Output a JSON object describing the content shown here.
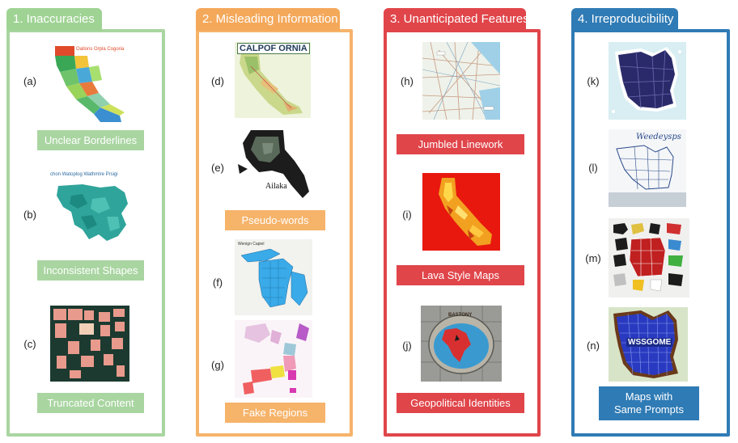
{
  "colors": {
    "green": "#a9d5a1",
    "green_tab": "#9fd394",
    "orange": "#f6b36a",
    "orange_tab": "#f4a85a",
    "red": "#e0454a",
    "red_tab": "#e0454a",
    "blue": "#2f7bb5",
    "blue_tab": "#2f7bb5"
  },
  "panels": [
    {
      "title": "1. Inaccuracies",
      "items": [
        {
          "label": "(a)",
          "caption": "Unclear Borderlines",
          "map_text": "Oallons Orpla Cogoria"
        },
        {
          "label": "(b)",
          "caption": "Inconsistent Shapes",
          "map_text": "chon Watoplog Wathmlre Prsigi"
        },
        {
          "label": "(c)",
          "caption": "Truncated Content"
        }
      ]
    },
    {
      "title": "2. Misleading Information",
      "items": [
        {
          "label": "(d)",
          "map_text": "CALPOF ORNIA"
        },
        {
          "label": "(e)",
          "map_text": "Ailaka"
        },
        {
          "label": "(f)",
          "map_text": "Wenign Capiel"
        },
        {
          "label": "(g)"
        }
      ],
      "captions": [
        "Pseudo-words",
        "Fake Regions"
      ]
    },
    {
      "title": "3. Unanticipated Features",
      "items": [
        {
          "label": "(h)",
          "caption": "Jumbled Linework"
        },
        {
          "label": "(i)",
          "caption": "Lava Style Maps"
        },
        {
          "label": "(j)",
          "caption": "Geopolitical Identities",
          "map_text": "BASTONY"
        }
      ]
    },
    {
      "title": "4. Irreproducibility",
      "items": [
        {
          "label": "(k)"
        },
        {
          "label": "(l)",
          "map_text": "Weedeysps"
        },
        {
          "label": "(m)"
        },
        {
          "label": "(n)",
          "map_text": "WSSGOME"
        }
      ],
      "caption": "Maps with Same Prompts"
    }
  ]
}
